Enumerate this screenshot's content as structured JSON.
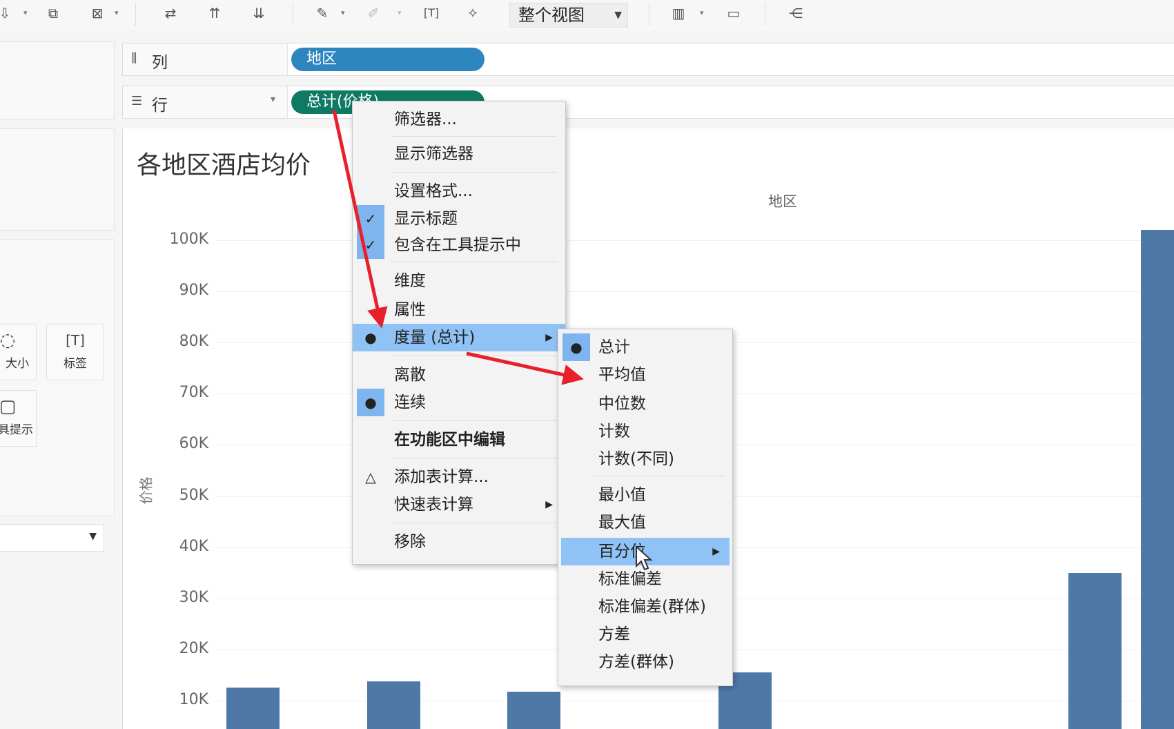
{
  "toolbar": {
    "view_dropdown": "整个视图"
  },
  "shelves": {
    "columns": {
      "label": "列",
      "pill": "地区",
      "pill_color": "#2e86c1"
    },
    "rows": {
      "label": "行",
      "pill": "总计(价格)",
      "pill_color": "#0f7a63"
    }
  },
  "marks": {
    "size_label": "大小",
    "label_label": "标签",
    "tooltip_label": "具提示"
  },
  "view": {
    "title": "各地区酒店均价",
    "column_header": "地区",
    "axis_title": "价格",
    "yticks": [
      "100K",
      "90K",
      "80K",
      "70K",
      "60K",
      "50K",
      "40K",
      "30K",
      "20K",
      "10K"
    ]
  },
  "chart_data": {
    "type": "bar",
    "title": "各地区酒店均价",
    "xlabel": "地区",
    "ylabel": "价格",
    "ylim": [
      0,
      105000
    ],
    "values": [
      12500,
      13800,
      11800,
      15500,
      35000,
      102000
    ],
    "bar_color": "#4e79a7"
  },
  "context_menu": {
    "items": [
      {
        "label": "筛选器...",
        "check": ""
      },
      {
        "label": "显示筛选器",
        "check": ""
      },
      {
        "label": "设置格式...",
        "check": ""
      },
      {
        "label": "显示标题",
        "check": "✓"
      },
      {
        "label": "包含在工具提示中",
        "check": "✓"
      },
      {
        "label": "维度",
        "check": ""
      },
      {
        "label": "属性",
        "check": ""
      },
      {
        "label": "度量 (总计)",
        "check": "●"
      },
      {
        "label": "离散",
        "check": ""
      },
      {
        "label": "连续",
        "check": "●"
      },
      {
        "label": "在功能区中编辑",
        "check": ""
      },
      {
        "label": "添加表计算...",
        "check": "△"
      },
      {
        "label": "快速表计算",
        "check": ""
      },
      {
        "label": "移除",
        "check": ""
      }
    ]
  },
  "submenu": {
    "items": [
      {
        "label": "总计",
        "check": "●"
      },
      {
        "label": "平均值",
        "check": ""
      },
      {
        "label": "中位数",
        "check": ""
      },
      {
        "label": "计数",
        "check": ""
      },
      {
        "label": "计数(不同)",
        "check": ""
      },
      {
        "label": "最小值",
        "check": ""
      },
      {
        "label": "最大值",
        "check": ""
      },
      {
        "label": "百分位",
        "check": ""
      },
      {
        "label": "标准偏差",
        "check": ""
      },
      {
        "label": "标准偏差(群体)",
        "check": ""
      },
      {
        "label": "方差",
        "check": ""
      },
      {
        "label": "方差(群体)",
        "check": ""
      }
    ]
  }
}
